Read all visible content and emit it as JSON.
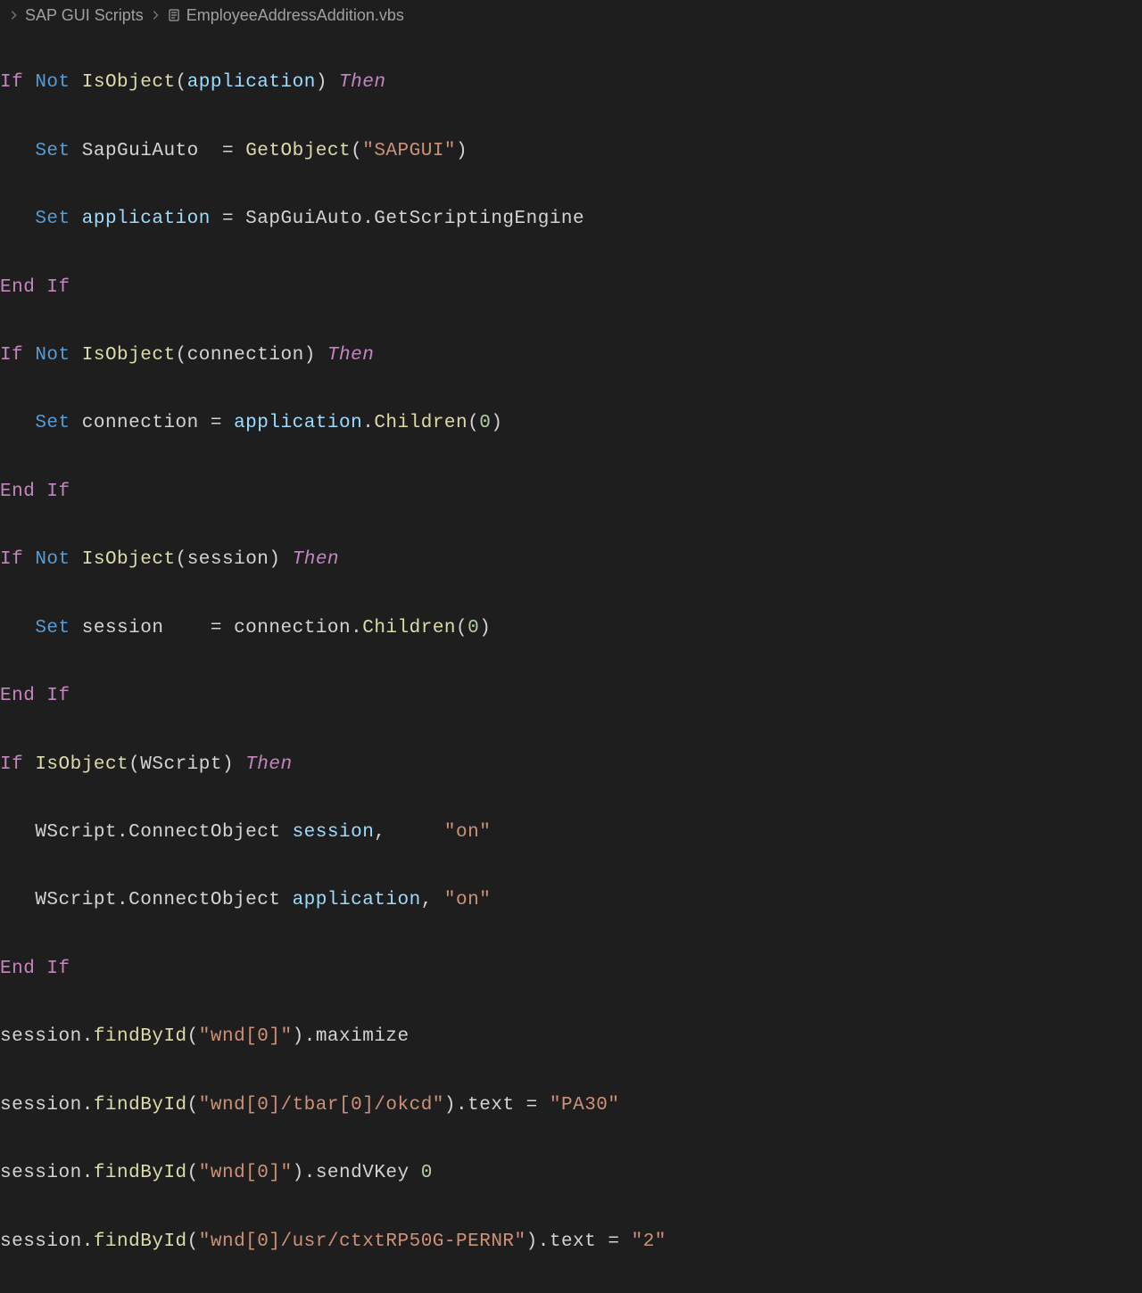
{
  "breadcrumb": {
    "folder": "SAP GUI Scripts",
    "file": "EmployeeAddressAddition.vbs"
  },
  "code": {
    "l1": {
      "If": "If",
      "Not": "Not",
      "IsObject": "IsObject",
      "application": "application",
      "Then": "Then"
    },
    "l2": {
      "Set": "Set",
      "SapGuiAuto": "SapGuiAuto",
      "eq": "  = ",
      "GetObject": "GetObject",
      "str": "\"SAPGUI\""
    },
    "l3": {
      "Set": "Set",
      "application": "application",
      "eq": " = ",
      "rhs": "SapGuiAuto.GetScriptingEngine"
    },
    "l4": {
      "EndIf": "End If"
    },
    "l5": {
      "If": "If",
      "Not": "Not",
      "IsObject": "IsObject",
      "connection": "connection",
      "Then": "Then"
    },
    "l6": {
      "Set": "Set",
      "connection": "connection",
      "eq": " = ",
      "application": "application",
      "Children": "Children",
      "zero": "0"
    },
    "l7": {
      "EndIf": "End If"
    },
    "l8": {
      "If": "If",
      "Not": "Not",
      "IsObject": "IsObject",
      "session": "session",
      "Then": "Then"
    },
    "l9": {
      "Set": "Set",
      "session": "session",
      "eq": "    = ",
      "connection": "connection",
      "Children": "Children",
      "zero": "0"
    },
    "l10": {
      "EndIf": "End If"
    },
    "l11": {
      "If": "If",
      "IsObject": "IsObject",
      "WScript": "WScript",
      "Then": "Then"
    },
    "l12": {
      "call": "WScript.ConnectObject",
      "session": "session",
      "comma": ",     ",
      "on": "\"on\""
    },
    "l13": {
      "call": "WScript.ConnectObject",
      "application": "application",
      "comma": ", ",
      "on": "\"on\""
    },
    "l14": {
      "EndIf": "End If"
    },
    "l15": {
      "session": "session",
      "findById": "findById",
      "arg": "\"wnd[0]\"",
      "maximize": "maximize"
    },
    "l16": {
      "session": "session",
      "findById": "findById",
      "arg": "\"wnd[0]/tbar[0]/okcd\"",
      "text": "text",
      "val": "\"PA30\""
    },
    "l17": {
      "session": "session",
      "findById": "findById",
      "arg": "\"wnd[0]\"",
      "sendVKey": "sendVKey",
      "zero": "0"
    },
    "l18": {
      "session": "session",
      "findById": "findById",
      "arg": "\"wnd[0]/usr/ctxtRP50G-PERNR\"",
      "text": "text",
      "val": "\"2\""
    }
  }
}
